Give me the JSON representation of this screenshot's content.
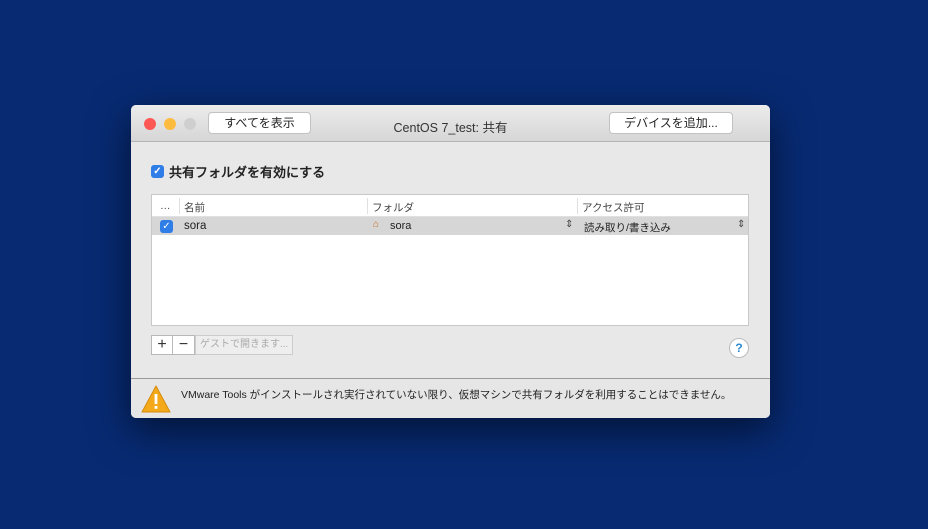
{
  "window": {
    "title": "CentOS 7_test: 共有",
    "show_all_label": "すべてを表示",
    "add_device_label": "デバイスを追加..."
  },
  "sharing": {
    "enable_label": "共有フォルダを有効にする",
    "enabled": true
  },
  "table": {
    "columns": [
      "…",
      "名前",
      "フォルダ",
      "アクセス許可"
    ],
    "rows": [
      {
        "checked": true,
        "name": "sora",
        "folder": "sora",
        "access": "読み取り/書き込み"
      }
    ]
  },
  "toolbar": {
    "add_label": "+",
    "remove_label": "−",
    "guest_label": "ゲストで開きます...",
    "help_label": "?"
  },
  "footer": {
    "message": "VMware Tools がインストールされ実行されていない限り、仮想マシンで共有フォルダを利用することはできません。"
  },
  "colors": {
    "background": "#072a72",
    "accent": "#2f7ee8"
  }
}
